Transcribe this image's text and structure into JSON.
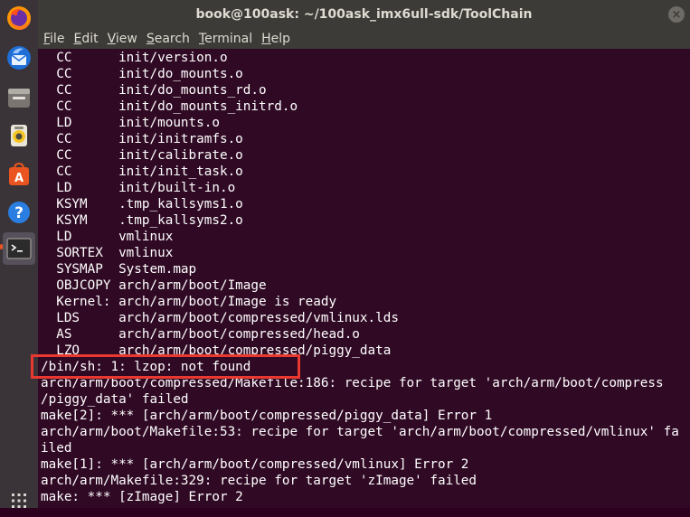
{
  "window": {
    "title": "book@100ask: ~/100ask_imx6ull-sdk/ToolChain"
  },
  "menu": [
    {
      "key": "F",
      "rest": "ile"
    },
    {
      "key": "E",
      "rest": "dit"
    },
    {
      "key": "V",
      "rest": "iew"
    },
    {
      "key": "S",
      "rest": "earch"
    },
    {
      "key": "T",
      "rest": "erminal"
    },
    {
      "key": "H",
      "rest": "elp"
    }
  ],
  "dock": [
    {
      "name": "firefox-icon"
    },
    {
      "name": "thunderbird-icon"
    },
    {
      "name": "files-icon"
    },
    {
      "name": "rhythmbox-icon"
    },
    {
      "name": "software-center-icon"
    },
    {
      "name": "help-icon"
    },
    {
      "name": "terminal-icon"
    },
    {
      "name": "show-applications-icon"
    }
  ],
  "terminal": {
    "lines": [
      "  CC      init/version.o",
      "  CC      init/do_mounts.o",
      "  CC      init/do_mounts_rd.o",
      "  CC      init/do_mounts_initrd.o",
      "  LD      init/mounts.o",
      "  CC      init/initramfs.o",
      "  CC      init/calibrate.o",
      "  CC      init/init_task.o",
      "  LD      init/built-in.o",
      "  KSYM    .tmp_kallsyms1.o",
      "  KSYM    .tmp_kallsyms2.o",
      "  LD      vmlinux",
      "  SORTEX  vmlinux",
      "  SYSMAP  System.map",
      "  OBJCOPY arch/arm/boot/Image",
      "  Kernel: arch/arm/boot/Image is ready",
      "  LDS     arch/arm/boot/compressed/vmlinux.lds",
      "  AS      arch/arm/boot/compressed/head.o",
      "  LZO     arch/arm/boot/compressed/piggy_data",
      "/bin/sh: 1: lzop: not found",
      "arch/arm/boot/compressed/Makefile:186: recipe for target 'arch/arm/boot/compressed/piggy_data' failed",
      "/piggy_data' failed",
      "make[2]: *** [arch/arm/boot/compressed/piggy_data] Error 1",
      "arch/arm/boot/Makefile:53: recipe for target 'arch/arm/boot/compressed/vmlinux' failed",
      "iled",
      "make[1]: *** [arch/arm/boot/compressed/vmlinux] Error 2",
      "arch/arm/Makefile:329: recipe for target 'zImage' failed",
      "make: *** [zImage] Error 2"
    ]
  },
  "colors": {
    "terminal_bg": "#300a24",
    "terminal_fg": "#ffffff",
    "highlight": "#e8382f"
  }
}
